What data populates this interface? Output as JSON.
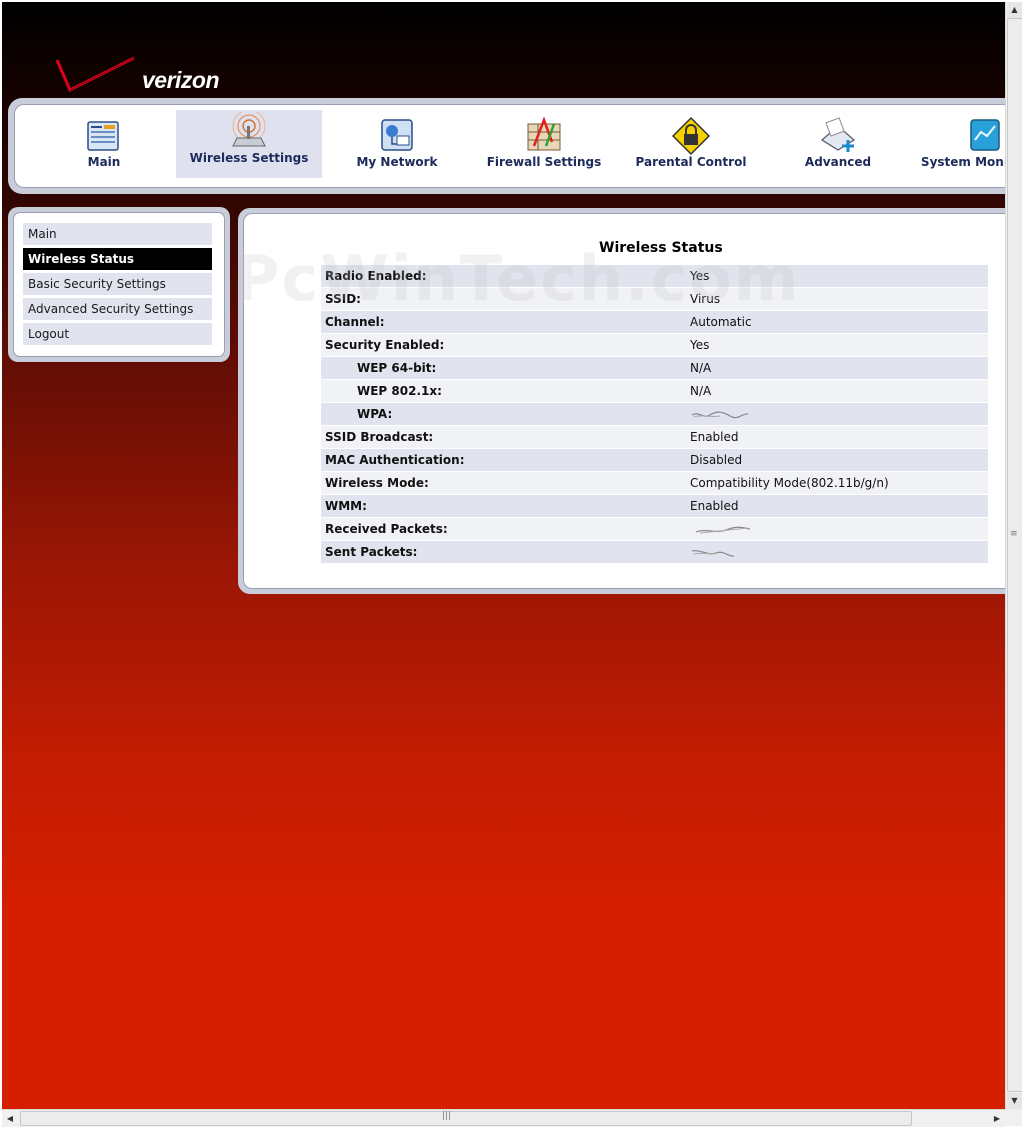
{
  "logo": {
    "text": "verizon"
  },
  "topnav": {
    "items": [
      {
        "label": "Main",
        "icon": "main-icon",
        "active": false
      },
      {
        "label": "Wireless Settings",
        "icon": "wireless-icon",
        "active": true
      },
      {
        "label": "My Network",
        "icon": "network-icon",
        "active": false
      },
      {
        "label": "Firewall Settings",
        "icon": "firewall-icon",
        "active": false
      },
      {
        "label": "Parental Control",
        "icon": "lock-icon",
        "active": false
      },
      {
        "label": "Advanced",
        "icon": "advanced-icon",
        "active": false
      },
      {
        "label": "System Monitoring",
        "icon": "monitor-icon",
        "active": false
      }
    ]
  },
  "sidebar": {
    "items": [
      {
        "label": "Main",
        "active": false
      },
      {
        "label": "Wireless Status",
        "active": true
      },
      {
        "label": "Basic Security Settings",
        "active": false
      },
      {
        "label": "Advanced Security Settings",
        "active": false
      },
      {
        "label": "Logout",
        "active": false
      }
    ]
  },
  "content": {
    "title": "Wireless Status",
    "watermark": "PcWinTech.com",
    "rows": [
      {
        "key": "Radio Enabled:",
        "value": "Yes"
      },
      {
        "key": "SSID:",
        "value": "Virus"
      },
      {
        "key": "Channel:",
        "value": "Automatic"
      },
      {
        "key": "Security Enabled:",
        "value": "Yes"
      },
      {
        "key": "WEP 64-bit:",
        "value": "N/A"
      },
      {
        "key": "WEP 802.1x:",
        "value": "N/A"
      },
      {
        "key": "WPA:",
        "value": ""
      },
      {
        "key": "SSID Broadcast:",
        "value": "Enabled"
      },
      {
        "key": "MAC Authentication:",
        "value": "Disabled"
      },
      {
        "key": "Wireless Mode:",
        "value": "Compatibility Mode(802.11b/g/n)"
      },
      {
        "key": "WMM:",
        "value": "Enabled"
      },
      {
        "key": "Received Packets:",
        "value": ""
      },
      {
        "key": "Sent Packets:",
        "value": ""
      }
    ]
  },
  "colors": {
    "accent": "#1c2b5a",
    "frame": "#c9cdd9",
    "row_odd": "#e1e4ee",
    "row_even": "#f1f2f6",
    "active_side": "#000000",
    "background_bottom": "#d61f00"
  }
}
